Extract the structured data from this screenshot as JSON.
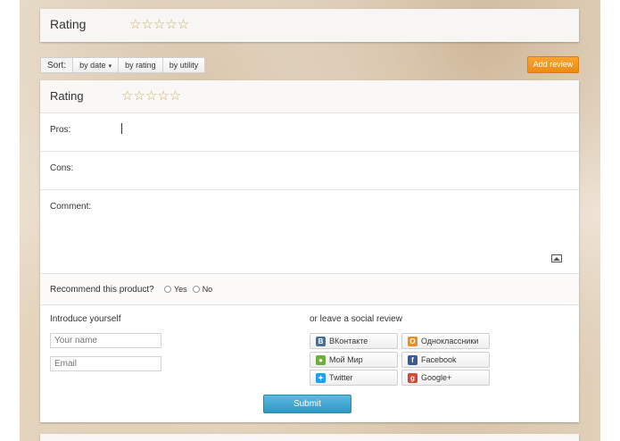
{
  "header": {
    "title": "Rating",
    "stars": "☆☆☆☆☆"
  },
  "sort": {
    "label": "Sort:",
    "options": [
      "by date",
      "by rating",
      "by utility"
    ],
    "caret": "▾"
  },
  "add_review_label": "Add review",
  "form": {
    "rating_label": "Rating",
    "stars": "☆☆☆☆☆",
    "pros_label": "Pros:",
    "cons_label": "Cons:",
    "comment_label": "Comment:",
    "recommend_label": "Recommend this product?",
    "yes_label": "Yes",
    "no_label": "No",
    "introduce_label": "Introduce yourself",
    "name_placeholder": "Your name",
    "email_placeholder": "Email",
    "social_label": "or leave a social review",
    "social": [
      {
        "label": "ВКонтакте",
        "icon": "vk-icon",
        "glyph": "В",
        "color": "#4a6e99"
      },
      {
        "label": "Одноклассники",
        "icon": "ok-icon",
        "glyph": "О",
        "color": "#f08c1b"
      },
      {
        "label": "Мой Мир",
        "icon": "mymir-icon",
        "glyph": "●",
        "color": "#6fae3a"
      },
      {
        "label": "Facebook",
        "icon": "facebook-icon",
        "glyph": "f",
        "color": "#3b5998"
      },
      {
        "label": "Twitter",
        "icon": "twitter-icon",
        "glyph": "✦",
        "color": "#1da1f2"
      },
      {
        "label": "Google+",
        "icon": "googleplus-icon",
        "glyph": "g",
        "color": "#d34836"
      }
    ],
    "submit_label": "Submit"
  }
}
